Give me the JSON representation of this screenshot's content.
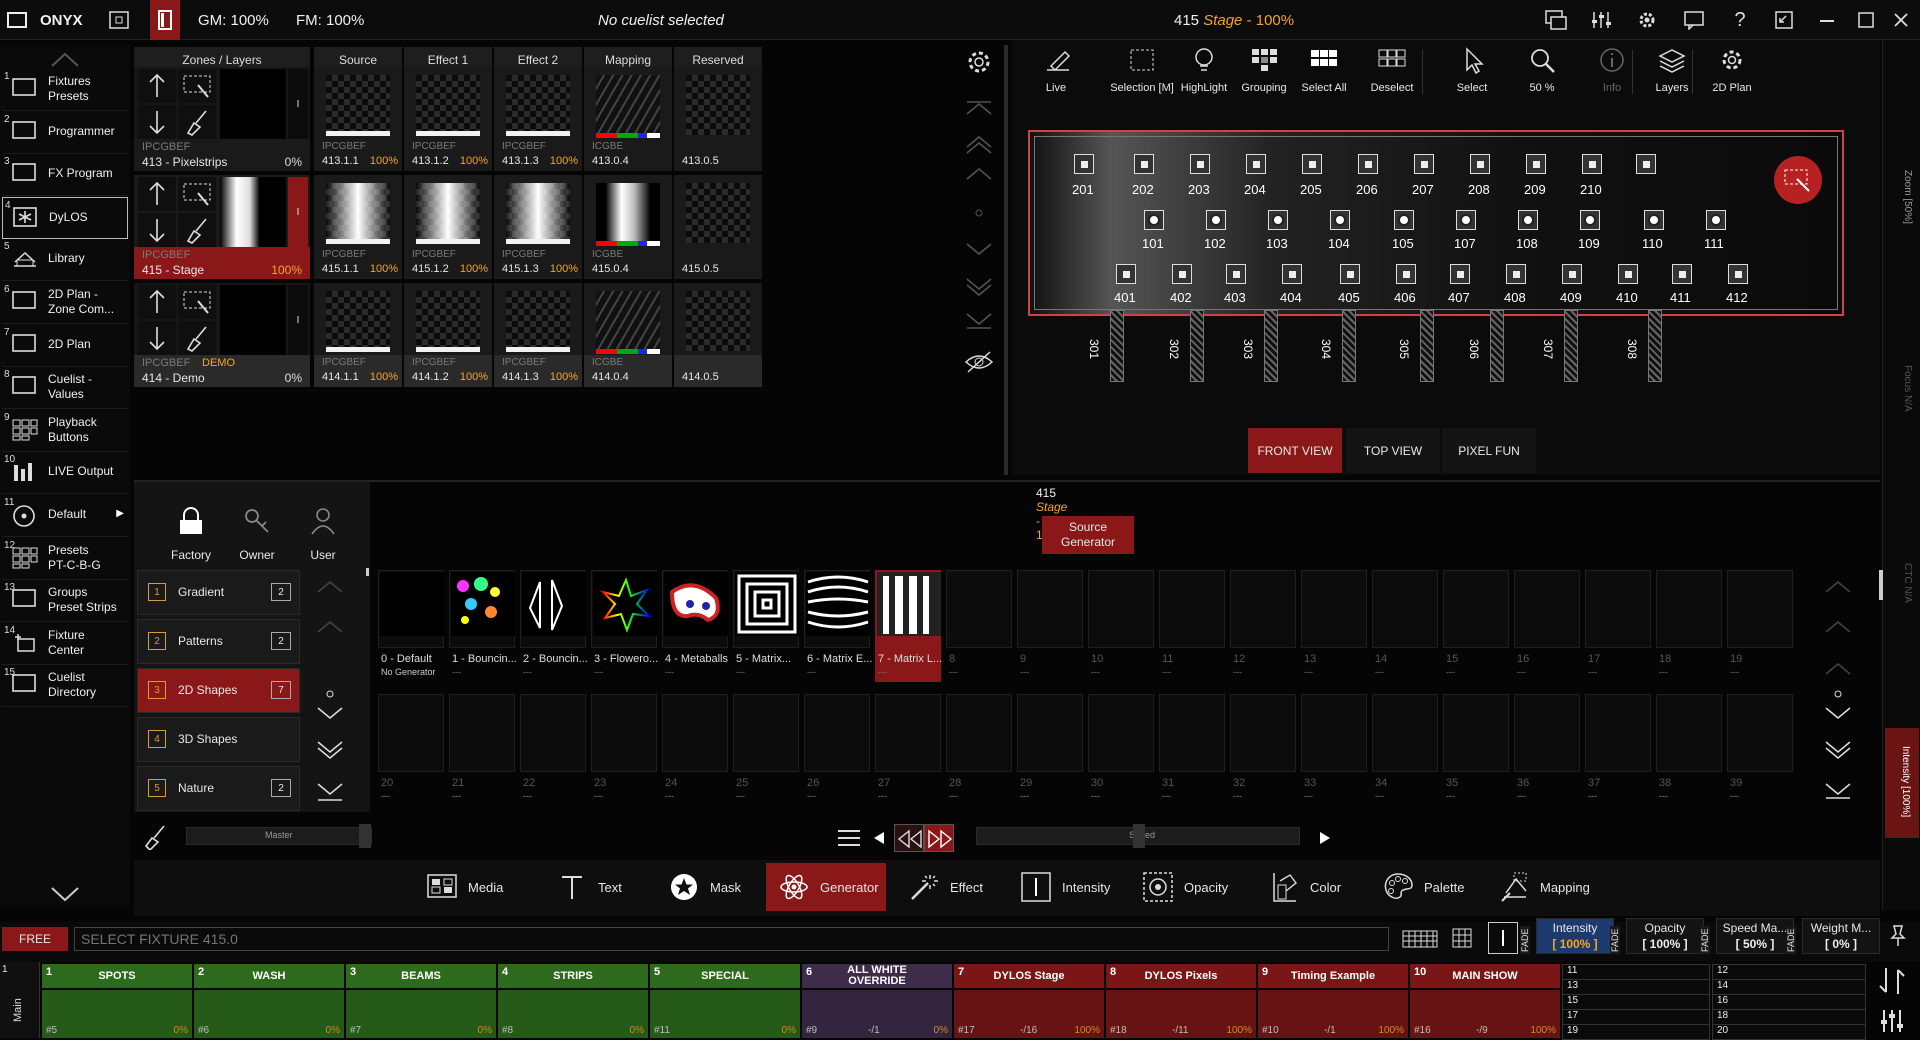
{
  "topbar": {
    "brand": "ONYX",
    "gm": "GM: 100%",
    "fm": "FM: 100%",
    "cuelist": "No cuelist selected",
    "selection_num": "415",
    "selection_name": "Stage",
    "selection_pct": "- 100%"
  },
  "sidebar": {
    "items": [
      {
        "n": "1",
        "label": "Fixtures\nPresets",
        "icon": "monitor-icon"
      },
      {
        "n": "2",
        "label": "Programmer",
        "icon": "monitor-icon"
      },
      {
        "n": "3",
        "label": "FX Program",
        "icon": "monitor-icon"
      },
      {
        "n": "4",
        "label": "DyLOS",
        "icon": "asterisk-icon"
      },
      {
        "n": "5",
        "label": "Library",
        "icon": "library-icon"
      },
      {
        "n": "6",
        "label": "2D Plan -\nZone Com...",
        "icon": "monitor-icon"
      },
      {
        "n": "7",
        "label": "2D Plan",
        "icon": "monitor-icon"
      },
      {
        "n": "8",
        "label": "Cuelist -\nValues",
        "icon": "monitor-icon"
      },
      {
        "n": "9",
        "label": "Playback\nButtons",
        "icon": "grid-icon"
      },
      {
        "n": "10",
        "label": "LIVE Output",
        "icon": "bars-icon"
      },
      {
        "n": "11",
        "label": "Default",
        "icon": "disc-icon"
      },
      {
        "n": "12",
        "label": "Presets\nPT-C-B-G",
        "icon": "grid-icon"
      },
      {
        "n": "13",
        "label": "Groups\nPreset Strips",
        "icon": "monitor-icon"
      },
      {
        "n": "14",
        "label": "Fixture\nCenter",
        "icon": "plus-icon"
      },
      {
        "n": "15",
        "label": "Cuelist\nDirectory",
        "icon": "monitor-icon"
      }
    ]
  },
  "layers": {
    "headers": [
      "Zones / Layers",
      "Source",
      "Effect 1",
      "Effect 2",
      "Mapping",
      "Reserved"
    ],
    "rows": [
      {
        "meta": "IPCGBEF",
        "name": "413 - Pixelstrips",
        "pct": "0%",
        "tag": "",
        "cells": [
          "413.1.1",
          "413.1.2",
          "413.1.3",
          "413.0.4",
          "413.0.5"
        ],
        "cellpct": "100%"
      },
      {
        "meta": "IPCGBEF",
        "name": "415 - Stage",
        "pct": "100%",
        "tag": "",
        "cells": [
          "415.1.1",
          "415.1.2",
          "415.1.3",
          "415.0.4",
          "415.0.5"
        ],
        "cellpct": "100%"
      },
      {
        "meta": "IPCGBEF",
        "name": "414 - Demo",
        "pct": "0%",
        "tag": "DEMO",
        "cells": [
          "414.1.1",
          "414.1.2",
          "414.1.3",
          "414.0.4",
          "414.0.5"
        ],
        "cellpct": "100%"
      }
    ],
    "meta_short": "ICGBE"
  },
  "plan_toolbar": [
    {
      "label": "Live",
      "icon": "pen-icon"
    },
    {
      "label": "Selection [M]",
      "icon": "selection-icon"
    },
    {
      "label": "HighLight",
      "icon": "bulb-icon"
    },
    {
      "label": "Grouping",
      "icon": "grouping-icon"
    },
    {
      "label": "Select All",
      "icon": "select-all-icon"
    },
    {
      "label": "Deselect",
      "icon": "deselect-icon"
    },
    {
      "label": "Select",
      "icon": "pointer-icon"
    },
    {
      "label": "50 %",
      "icon": "zoom-icon"
    },
    {
      "label": "Info",
      "icon": "info-icon"
    },
    {
      "label": "Layers",
      "icon": "layers-icon"
    },
    {
      "label": "2D Plan",
      "icon": "gear-icon"
    }
  ],
  "plan": {
    "row1": [
      "201",
      "202",
      "203",
      "204",
      "205",
      "206",
      "207",
      "208",
      "209",
      "210"
    ],
    "row2": [
      "101",
      "102",
      "103",
      "104",
      "105",
      "107",
      "108",
      "109",
      "110",
      "111"
    ],
    "row3": [
      "401",
      "402",
      "403",
      "404",
      "405",
      "406",
      "407",
      "408",
      "409",
      "410",
      "411",
      "412"
    ],
    "truss": [
      "301",
      "302",
      "303",
      "304",
      "305",
      "306",
      "307",
      "308"
    ],
    "views": [
      "FRONT VIEW",
      "TOP VIEW",
      "PIXEL FUN"
    ],
    "side_zoom": "Zoom",
    "side_zoom_v": "[50%]",
    "side_focus": "Focus",
    "side_focus_v": "N/A",
    "side_ctc": "CTC",
    "side_ctc_v": "N/A",
    "side_int": "Intensity",
    "side_int_v": "[100%]"
  },
  "library": {
    "filters": [
      "Factory",
      "Owner",
      "User"
    ],
    "cats": [
      {
        "n": "1",
        "label": "Gradient",
        "c": "2"
      },
      {
        "n": "2",
        "label": "Patterns",
        "c": "2"
      },
      {
        "n": "3",
        "label": "2D Shapes",
        "c": "7"
      },
      {
        "n": "4",
        "label": "3D Shapes",
        "c": ""
      },
      {
        "n": "5",
        "label": "Nature",
        "c": "2"
      }
    ],
    "head_num": "415",
    "head_name": "Stage",
    "head_pct": "- 100%",
    "source_btn": "Source\nGenerator",
    "slots1": [
      {
        "l": "0 - Default",
        "d": "No Generator"
      },
      {
        "l": "1 - Bouncin...",
        "d": "---"
      },
      {
        "l": "2 - Bouncin...",
        "d": "---"
      },
      {
        "l": "3 - Flowero...",
        "d": "---"
      },
      {
        "l": "4 - Metaballs",
        "d": "---"
      },
      {
        "l": "5 - Matrix...",
        "d": "---"
      },
      {
        "l": "6 - Matrix E...",
        "d": "---"
      },
      {
        "l": "7 - Matrix L...",
        "d": "---"
      },
      {
        "l": "8",
        "d": "---"
      },
      {
        "l": "9",
        "d": "---"
      },
      {
        "l": "10",
        "d": "---"
      },
      {
        "l": "11",
        "d": "---"
      },
      {
        "l": "12",
        "d": "---"
      },
      {
        "l": "13",
        "d": "---"
      },
      {
        "l": "14",
        "d": "---"
      },
      {
        "l": "15",
        "d": "---"
      },
      {
        "l": "16",
        "d": "---"
      },
      {
        "l": "17",
        "d": "---"
      },
      {
        "l": "18",
        "d": "---"
      },
      {
        "l": "19",
        "d": "---"
      }
    ],
    "slots2": [
      "20",
      "21",
      "22",
      "23",
      "24",
      "25",
      "26",
      "27",
      "28",
      "29",
      "30",
      "31",
      "32",
      "33",
      "34",
      "35",
      "36",
      "37",
      "38",
      "39"
    ],
    "master": "Master",
    "speed": "Speed"
  },
  "tabs": [
    {
      "label": "Media",
      "icon": "media-icon"
    },
    {
      "label": "Text",
      "icon": "text-icon"
    },
    {
      "label": "Mask",
      "icon": "mask-icon"
    },
    {
      "label": "Generator",
      "icon": "atom-icon"
    },
    {
      "label": "Effect",
      "icon": "wand-icon"
    },
    {
      "label": "Intensity",
      "icon": "intensity-icon"
    },
    {
      "label": "Opacity",
      "icon": "opacity-icon"
    },
    {
      "label": "Color",
      "icon": "color-icon"
    },
    {
      "label": "Palette",
      "icon": "palette-icon"
    },
    {
      "label": "Mapping",
      "icon": "mapping-icon"
    }
  ],
  "command": {
    "free": "FREE",
    "placeholder": "SELECT FIXTURE 415.0"
  },
  "faders": [
    {
      "l": "Intensity",
      "v": "[ 100% ]"
    },
    {
      "l": "Opacity",
      "v": "[ 100% ]"
    },
    {
      "l": "Speed Ma...",
      "v": "[ 50% ]"
    },
    {
      "l": "Weight M...",
      "v": "[ 0% ]"
    }
  ],
  "fade_label": "FADE",
  "main_label": "Main",
  "playbacks": [
    {
      "n": "1",
      "label": "SPOTS",
      "l": "#5",
      "m": "",
      "r": "0%",
      "color": "#2d6a1c"
    },
    {
      "n": "2",
      "label": "WASH",
      "l": "#6",
      "m": "",
      "r": "0%",
      "color": "#2d6a1c"
    },
    {
      "n": "3",
      "label": "BEAMS",
      "l": "#7",
      "m": "",
      "r": "0%",
      "color": "#2d6a1c"
    },
    {
      "n": "4",
      "label": "STRIPS",
      "l": "#8",
      "m": "",
      "r": "0%",
      "color": "#2d6a1c"
    },
    {
      "n": "5",
      "label": "SPECIAL",
      "l": "#11",
      "m": "",
      "r": "0%",
      "color": "#2d6a1c"
    },
    {
      "n": "6",
      "label": "ALL WHITE\nOVERRIDE",
      "l": "#9",
      "m": "-/1",
      "r": "0%",
      "color": "#3d2c4a"
    },
    {
      "n": "7",
      "label": "DYLOS Stage",
      "l": "#17",
      "m": "-/16",
      "r": "100%",
      "color": "#7a1616"
    },
    {
      "n": "8",
      "label": "DYLOS Pixels",
      "l": "#18",
      "m": "-/11",
      "r": "100%",
      "color": "#7a1616"
    },
    {
      "n": "9",
      "label": "Timing Example",
      "l": "#10",
      "m": "-/1",
      "r": "100%",
      "color": "#7a1616"
    },
    {
      "n": "10",
      "label": "MAIN SHOW",
      "l": "#16",
      "m": "-/9",
      "r": "100%",
      "color": "#7a1616"
    }
  ],
  "mini_left": [
    "11",
    "13",
    "15",
    "17",
    "19"
  ],
  "mini_right": [
    "12",
    "14",
    "16",
    "18",
    "20"
  ],
  "colors": {
    "accent_red": "#8a1818",
    "orange": "#f4a52a",
    "green": "#2d6a1c"
  }
}
